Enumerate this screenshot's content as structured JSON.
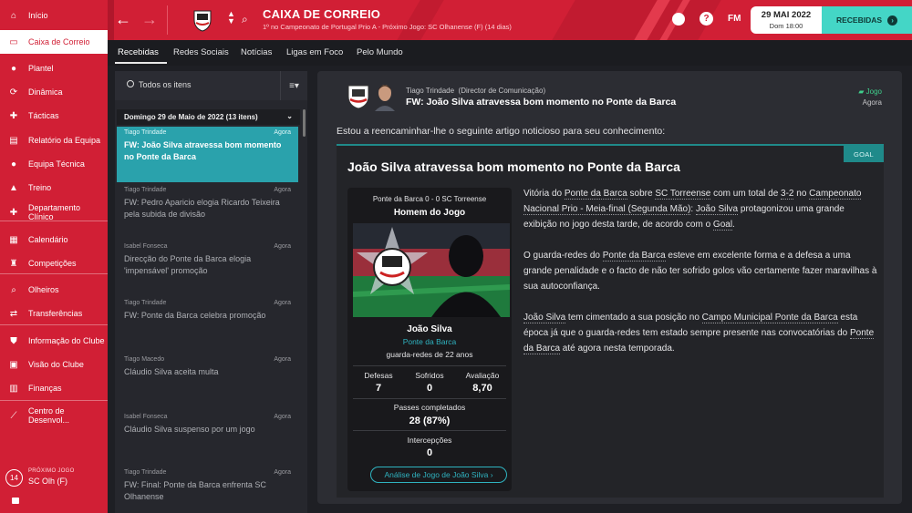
{
  "sidebar": {
    "items": [
      {
        "label": "Início",
        "icon": "home-icon"
      },
      {
        "label": "Caixa de Correio",
        "icon": "inbox-icon"
      },
      {
        "label": "Plantel",
        "icon": "squad-icon"
      },
      {
        "label": "Dinâmica",
        "icon": "dynamics-icon"
      },
      {
        "label": "Tácticas",
        "icon": "tactics-icon"
      },
      {
        "label": "Relatório da Equipa",
        "icon": "report-icon"
      },
      {
        "label": "Equipa Técnica",
        "icon": "staff-icon"
      },
      {
        "label": "Treino",
        "icon": "training-icon"
      },
      {
        "label": "Departamento Clínico",
        "icon": "medical-icon"
      },
      {
        "label": "Calendário",
        "icon": "calendar-icon"
      },
      {
        "label": "Competições",
        "icon": "trophy-icon"
      },
      {
        "label": "Olheiros",
        "icon": "scouting-icon"
      },
      {
        "label": "Transferências",
        "icon": "transfers-icon"
      },
      {
        "label": "Informação do Clube",
        "icon": "club-info-icon"
      },
      {
        "label": "Visão do Clube",
        "icon": "club-vision-icon"
      },
      {
        "label": "Finanças",
        "icon": "finances-icon"
      },
      {
        "label": "Centro de Desenvol...",
        "icon": "development-icon"
      }
    ],
    "next_match": {
      "label": "PRÓXIMO JOGO",
      "opponent": "SC Olh (F)",
      "days": "14"
    }
  },
  "header": {
    "title": "CAIXA DE CORREIO",
    "subtitle": "1º no Campeonato de Portugal Prio A - Próximo Jogo: SC Olhanense (F) (14 dias)",
    "fm_label": "FM",
    "help_label": "?",
    "date": "29 MAI 2022",
    "day_time": "Dom 18:00",
    "continue_label": "RECEBIDAS"
  },
  "tabs": [
    "Recebidas",
    "Redes Sociais",
    "Notícias",
    "Ligas em Foco",
    "Pelo Mundo"
  ],
  "inbox": {
    "filter_label": "Todos os itens",
    "date_group": "Domingo 29 de Maio de 2022 (13 itens)",
    "messages": [
      {
        "from": "Tiago Trindade",
        "time": "Agora",
        "subject": "FW: João Silva atravessa bom momento no Ponte da Barca"
      },
      {
        "from": "Tiago Trindade",
        "time": "Agora",
        "subject": "FW: Pedro Aparicio elogia Ricardo Teixeira pela subida de divisão"
      },
      {
        "from": "Isabel Fonseca",
        "time": "Agora",
        "subject": "Direcção do Ponte da Barca elogia 'impensável' promoção"
      },
      {
        "from": "Tiago Trindade",
        "time": "Agora",
        "subject": "FW: Ponte da Barca celebra promoção"
      },
      {
        "from": "Tiago Macedo",
        "time": "Agora",
        "subject": "Cláudio Silva aceita multa"
      },
      {
        "from": "Isabel Fonseca",
        "time": "Agora",
        "subject": "Cláudio Silva suspenso por um jogo"
      },
      {
        "from": "Tiago Trindade",
        "time": "Agora",
        "subject": "FW: Final: Ponte da Barca enfrenta SC Olhanense"
      }
    ]
  },
  "message": {
    "sender": "Tiago Trindade",
    "sender_role": "(Director de Comunicação)",
    "subject": "FW: João Silva atravessa bom momento no Ponte da Barca",
    "tag": "Jogo",
    "time": "Agora",
    "intro": "Estou a reencaminhar-lhe o seguinte artigo noticioso para seu conhecimento:",
    "article": {
      "tag": "GOAL",
      "title": "João Silva atravessa bom momento no Ponte da Barca",
      "p1_a": "Vitória do ",
      "p1_club": "Ponte da Barca",
      "p1_b": " sobre ",
      "p1_opp": "SC Torreense",
      "p1_c": " com um total de ",
      "p1_score": "3-2",
      "p1_d": " no ",
      "p1_comp": "Campeonato Nacional Prio - Meia-final (Segunda Mão)",
      "p1_e": ": ",
      "p1_player": "João Silva",
      "p1_f": " protagonizou uma grande exibição no jogo desta tarde, de acordo com o ",
      "p1_media": "Goal",
      "p1_g": ".",
      "p2_a": "O guarda-redes do ",
      "p2_club": "Ponte da Barca",
      "p2_b": " esteve em excelente forma e a defesa a uma grande penalidade e o facto de não ter sofrido golos vão certamente fazer maravilhas à sua autoconfiança.",
      "p3_player": "João Silva",
      "p3_a": " tem cimentado a sua posição no ",
      "p3_stadium": "Campo Municipal Ponte da Barca",
      "p3_b": " esta época já que o guarda-redes tem estado sempre presente nas convocatórias do ",
      "p3_club": "Ponte da Barca",
      "p3_c": " até agora nesta temporada."
    },
    "card": {
      "score": "Ponte da Barca 0 - 0 SC Torreense",
      "heading": "Homem do Jogo",
      "player": "João Silva",
      "club": "Ponte da Barca",
      "position": "guarda-redes de 22 anos",
      "stats": [
        {
          "label": "Defesas",
          "value": "7"
        },
        {
          "label": "Sofridos",
          "value": "0"
        },
        {
          "label": "Avaliação",
          "value": "8,70"
        }
      ],
      "passes_label": "Passes completados",
      "passes_value": "28 (87%)",
      "intercepts_label": "Intercepções",
      "intercepts_value": "0",
      "cta": "Análise de Jogo de João Silva"
    }
  },
  "colors": {
    "brand": "#d11f35",
    "accent": "#2aa2ac",
    "continue": "#44d6c6"
  }
}
